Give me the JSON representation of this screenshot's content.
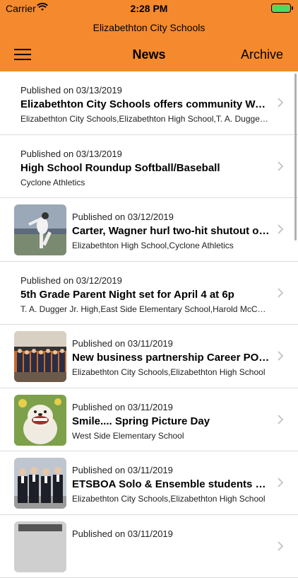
{
  "status": {
    "carrier": "Carrier",
    "time": "2:28 PM"
  },
  "app_title": "Elizabethton City Schools",
  "nav": {
    "title": "News",
    "archive_label": "Archive"
  },
  "articles": [
    {
      "date": "Published on 03/13/2019",
      "title": "Elizabethton City Schools offers community Water Safety Instruction",
      "sub": "Elizabethton City Schools,Elizabethton High School,T. A. Dugger Jr. High",
      "image": false
    },
    {
      "date": "Published on 03/13/2019",
      "title": "High School Roundup Softball/Baseball",
      "sub": "Cyclone Athletics",
      "image": false
    },
    {
      "date": "Published on 03/12/2019",
      "title": "Carter, Wagner hurl two-hit shutout over rival",
      "sub": "Elizabethton High School,Cyclone Athletics",
      "image": true
    },
    {
      "date": "Published on 03/12/2019",
      "title": "5th Grade Parent Night set for April 4 at 6p",
      "sub": "T. A. Dugger Jr. High,East Side Elementary School,Harold McCormick",
      "image": false
    },
    {
      "date": "Published on 03/11/2019",
      "title": "New business partnership Career POP takes off",
      "sub": "Elizabethton City Schools,Elizabethton High School",
      "image": true
    },
    {
      "date": "Published on 03/11/2019",
      "title": "Smile.... Spring Picture Day",
      "sub": "West Side Elementary School",
      "image": true
    },
    {
      "date": "Published on 03/11/2019",
      "title": "ETSBOA Solo & Ensemble students excel",
      "sub": "Elizabethton City Schools,Elizabethton High School",
      "image": true
    },
    {
      "date": "Published on 03/11/2019",
      "title": "",
      "sub": "",
      "image": true
    }
  ],
  "colors": {
    "header": "#f48a2d",
    "battery": "#4cd964"
  }
}
